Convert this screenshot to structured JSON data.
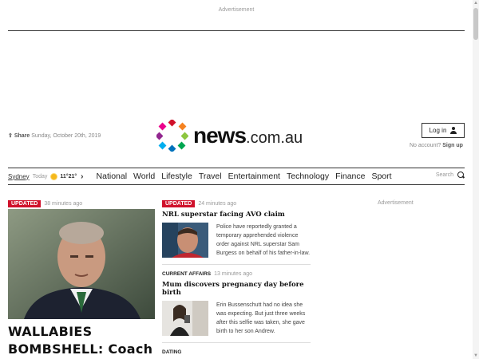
{
  "top_ad": {
    "label": "Advertisement"
  },
  "header": {
    "share_label": "Share",
    "date": "Sunday, October 20th, 2019",
    "logo_text": "news",
    "logo_domain": ".com.au",
    "login_label": "Log in",
    "no_account": "No account?",
    "signup": "Sign up"
  },
  "weather": {
    "city": "Sydney",
    "day": "Today",
    "temps": "11°21°"
  },
  "nav": {
    "sections": [
      "National",
      "World",
      "Lifestyle",
      "Travel",
      "Entertainment",
      "Technology",
      "Finance",
      "Sport"
    ],
    "search_label": "Search"
  },
  "lead_story": {
    "badge": "UPDATED",
    "time": "38 minutes ago",
    "headline_line1": "WALLABIES",
    "headline_line2": "BOMBSHELL: Coach"
  },
  "stories": [
    {
      "badge": "UPDATED",
      "time": "24 minutes ago",
      "title": "NRL superstar facing AVO claim",
      "summary": "Police have reportedly granted a temporary apprehended violence order against NRL superstar Sam Burgess on behalf of his father-in-law."
    },
    {
      "kicker": "CURRENT AFFAIRS",
      "time": "13 minutes ago",
      "title": "Mum discovers pregnancy day before birth",
      "summary": "Erin Bussenschutt had no idea she was expecting. But just three weeks after this selfie was taken, she gave birth to her son Andrew."
    },
    {
      "kicker": "DATING"
    }
  ],
  "side_ad": {
    "label": "Advertisement"
  },
  "colors": {
    "brand_red": "#d0112b",
    "nav_border": "#333333"
  }
}
